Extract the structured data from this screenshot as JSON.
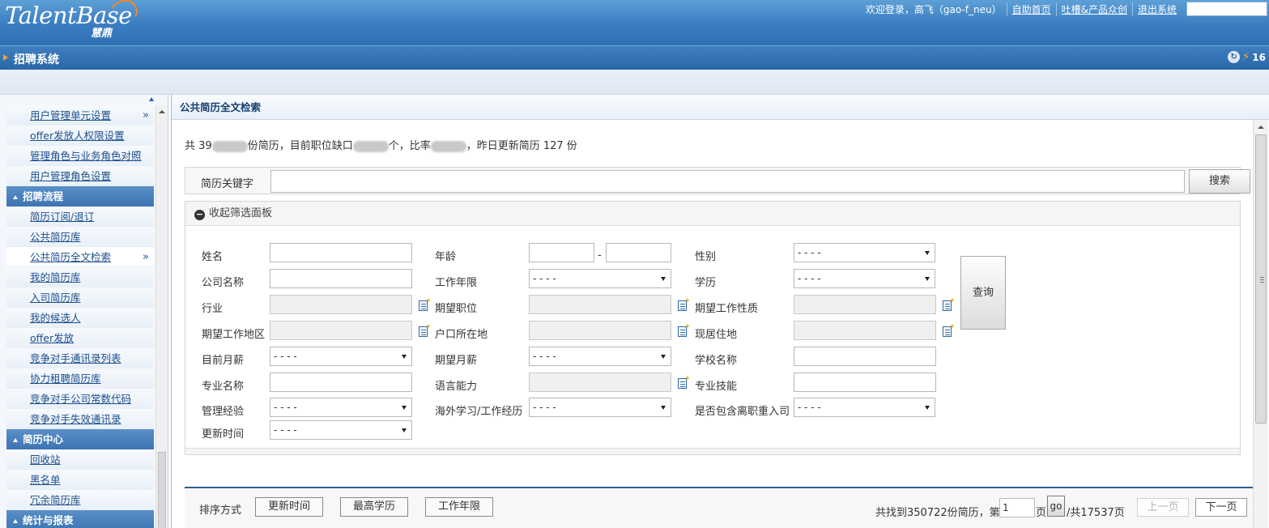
{
  "header": {
    "logo_text": "TalentBase",
    "logo_cn": "慧鼎",
    "welcome": "欢迎登录，高飞（gao-f_neu）",
    "links": [
      "自助首页",
      "吐槽&产品众创",
      "退出系统"
    ]
  },
  "sysbar": {
    "title": "招聘系统",
    "count": "16"
  },
  "sidebar": {
    "groups": [
      {
        "items": [
          "用户管理单元设置",
          "offer发放人权限设置",
          "管理角色与业务角色对照",
          "用户管理角色设置"
        ]
      },
      {
        "title": "招聘流程",
        "items": [
          "简历订阅/退订",
          "公共简历库",
          "公共简历全文检索",
          "我的简历库",
          "入司简历库",
          "我的候选人",
          "offer发放",
          "竞争对手通讯录列表",
          "协力租聘简历库",
          "竞争对手公司常数代码",
          "竞争对手失效通讯录"
        ]
      },
      {
        "title": "简历中心",
        "items": [
          "回收站",
          "黑名单",
          "冗余简历库"
        ]
      },
      {
        "title": "统计与报表",
        "items": []
      }
    ],
    "active_item": "公共简历全文检索"
  },
  "main": {
    "title": "公共简历全文检索",
    "stats": {
      "p1": "共 39",
      "p2": "份简历，目前职位缺口",
      "p3": "个，比率",
      "p4": "，昨日更新简历 127 份"
    },
    "keyword_label": "简历关键字",
    "keyword_value": "",
    "search_btn": "搜索",
    "filter_toggle": "收起筛选面板",
    "query_btn": "查询",
    "dash": "-",
    "select_placeholder": "- - - -",
    "fields": {
      "name": "姓名",
      "age": "年龄",
      "gender": "性别",
      "company": "公司名称",
      "work_years": "工作年限",
      "education": "学历",
      "industry": "行业",
      "expected_position": "期望职位",
      "expected_nature": "期望工作性质",
      "expected_area": "期望工作地区",
      "hukou": "户口所在地",
      "residence": "现居住地",
      "current_salary": "目前月薪",
      "expected_salary": "期望月薪",
      "school": "学校名称",
      "major": "专业名称",
      "language": "语言能力",
      "skill": "专业技能",
      "mgmt_exp": "管理经验",
      "overseas": "海外学习/工作经历",
      "include_left": "是否包含离职重入司",
      "update_time": "更新时间"
    },
    "sort": {
      "label": "排序方式",
      "options": [
        "更新时间",
        "最高学历",
        "工作年限"
      ]
    },
    "pager": {
      "found_pre": "共找到350722份简历，第",
      "page_value": "1",
      "page_unit": "页",
      "go": "go",
      "total": "/共17537页",
      "prev": "上一页",
      "next": "下一页"
    }
  }
}
